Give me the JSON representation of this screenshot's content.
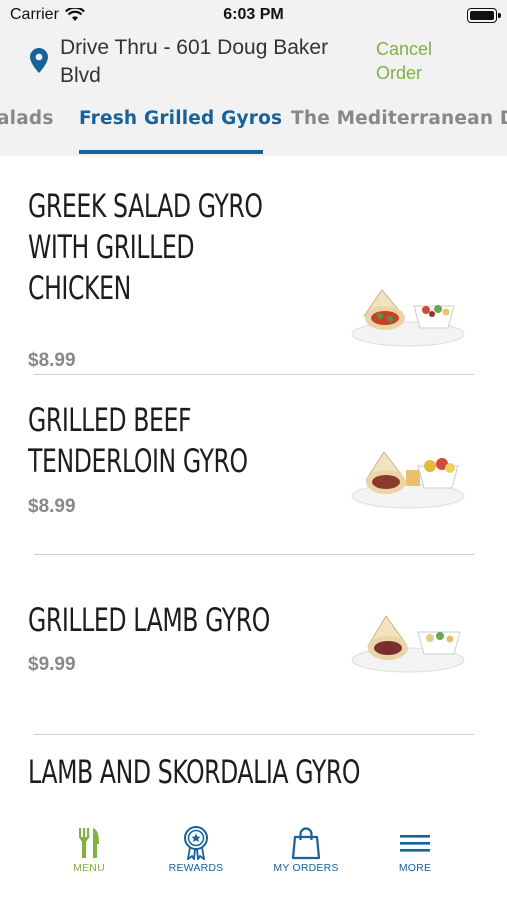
{
  "status_bar": {
    "carrier": "Carrier",
    "time": "6:03 PM"
  },
  "header": {
    "address": "Drive Thru - 601 Doug Baker Blvd",
    "cancel_label": "Cancel Order",
    "accent_color": "#7fb241"
  },
  "category_tabs": [
    {
      "label": "alads",
      "active": false
    },
    {
      "label": "Fresh Grilled Gyros",
      "active": true
    },
    {
      "label": "The Mediterranean De",
      "active": false
    }
  ],
  "menu_items": [
    {
      "name": "GREEK SALAD GYRO WITH GRILLED CHICKEN",
      "price": "$8.99"
    },
    {
      "name": "GRILLED BEEF TENDERLOIN GYRO",
      "price": "$8.99"
    },
    {
      "name": "GRILLED LAMB GYRO",
      "price": "$9.99"
    },
    {
      "name": "LAMB AND SKORDALIA GYRO",
      "price": ""
    }
  ],
  "bottom_nav": [
    {
      "label": "MENU",
      "icon": "fork-knife-icon",
      "active": true
    },
    {
      "label": "REWARDS",
      "icon": "rewards-badge-icon",
      "active": false
    },
    {
      "label": "MY ORDERS",
      "icon": "shopping-bag-icon",
      "active": false
    },
    {
      "label": "MORE",
      "icon": "hamburger-menu-icon",
      "active": false
    }
  ],
  "colors": {
    "brand_blue": "#16629a",
    "brand_green": "#7fb241"
  }
}
